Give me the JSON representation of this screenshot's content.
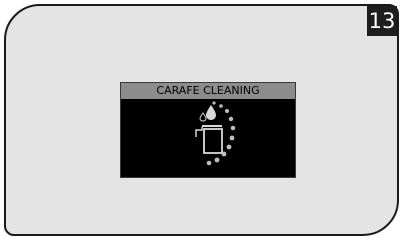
{
  "step": {
    "number": "13"
  },
  "display": {
    "title": "CARAFE CLEANING",
    "icons": [
      "drop-icon",
      "carafe-icon",
      "progress-dots-icon"
    ]
  },
  "colors": {
    "panel_background": "#e4e4e4",
    "screen_background": "#000000",
    "screen_header": "#8c8c8c",
    "icon_color": "#d9d9d9"
  }
}
